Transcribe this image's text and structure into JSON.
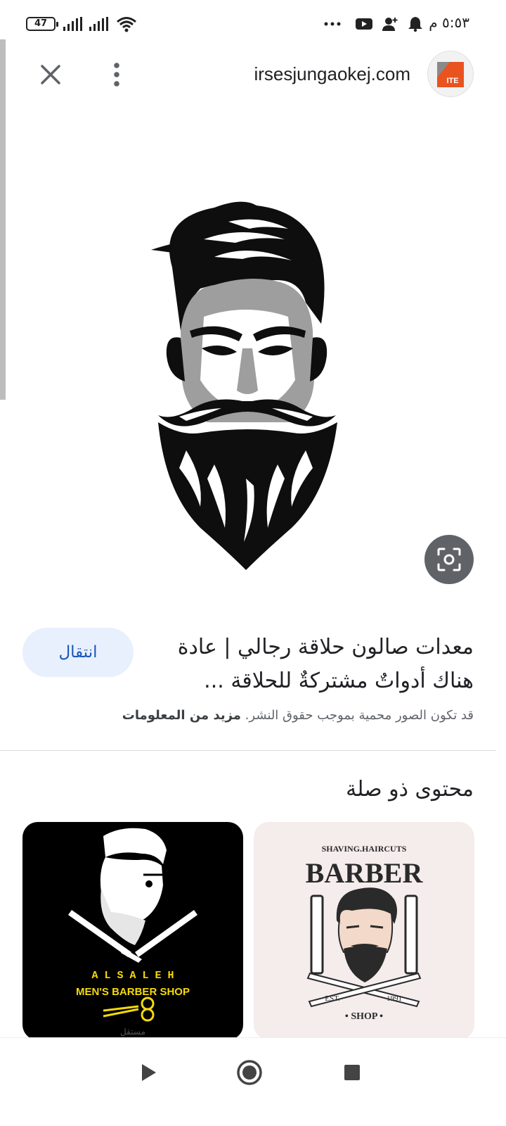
{
  "status_bar": {
    "battery": "47",
    "time": "٥:٥٣ م",
    "icons": [
      "battery-icon",
      "signal-icon",
      "signal-icon",
      "wifi-icon",
      "more-dots-icon",
      "youtube-icon",
      "add-person-icon",
      "bell-icon"
    ]
  },
  "header": {
    "domain": "irsesjungaokej.com",
    "close_icon": "close-icon",
    "more_icon": "more-vert-icon",
    "logo_text": "ITE"
  },
  "main": {
    "image_alt": "bearded-man-illustration",
    "lens_icon": "lens-search-icon"
  },
  "info": {
    "visit_label": "انتقال",
    "title": "معدات صالون حلاقة رجالي | عادة هناك أدواتٌ مشتركةٌ للحلاقة ...",
    "copyright_text": "قد تكون الصور محمية بموجب حقوق النشر.",
    "more_info": "مزيد من المعلومات"
  },
  "related": {
    "title": "محتوى ذو صلة",
    "cards": [
      {
        "line1": "A L   S A L E H",
        "line2": "MEN'S BARBER SHOP",
        "watermark": "مستقل"
      },
      {
        "top": "SHAVING.HAIRCUTS",
        "main": "BARBER",
        "est": "EST.",
        "year": "1991",
        "bottom": "• SHOP •"
      }
    ]
  },
  "nav": {
    "back": "back-icon",
    "home": "home-icon",
    "recent": "recent-apps-icon"
  },
  "colors": {
    "visit_bg": "#e8f0fe",
    "visit_text": "#1a56b8",
    "lens_bg": "#5f6368",
    "card_right_bg": "#f5ecec",
    "logo_orange": "#e8531f"
  }
}
